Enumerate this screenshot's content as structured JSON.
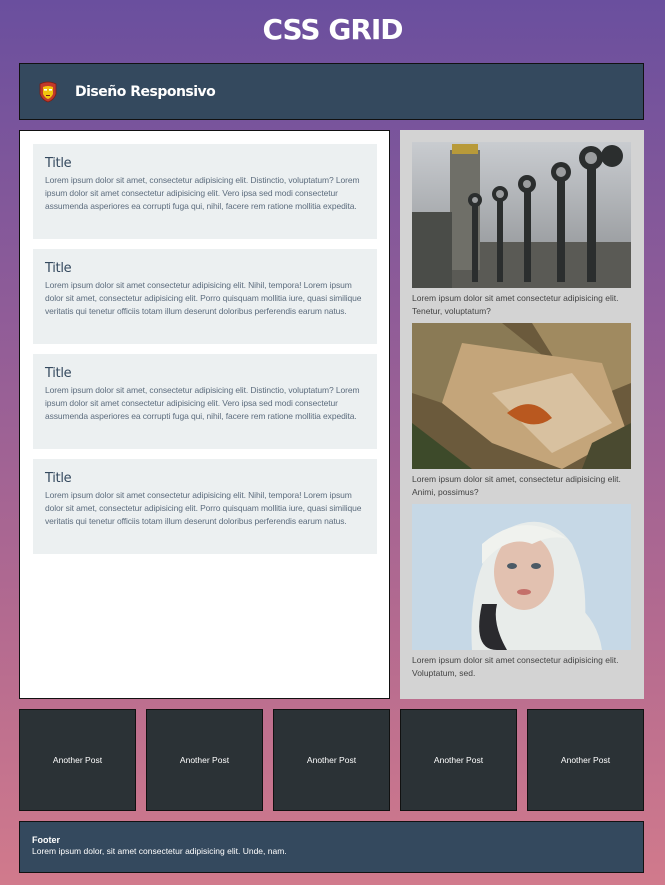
{
  "page": {
    "title": "CSS GRID"
  },
  "header": {
    "brand": "Diseño Responsivo",
    "logo_icon": "iron-man-mask-icon"
  },
  "main": {
    "cards": [
      {
        "title": "Title",
        "text": "Lorem ipsum dolor sit amet, consectetur adipisicing elit. Distinctio, voluptatum? Lorem ipsum dolor sit amet consectetur adipisicing elit. Vero ipsa sed modi consectetur assumenda asperiores ea corrupti fuga qui, nihil, facere rem ratione mollitia expedita."
      },
      {
        "title": "Title",
        "text": "Lorem ipsum dolor sit amet consectetur adipisicing elit. Nihil, tempora! Lorem ipsum dolor sit amet, consectetur adipisicing elit. Porro quisquam mollitia iure, quasi similique veritatis qui tenetur officiis totam illum deserunt doloribus perferendis earum natus."
      },
      {
        "title": "Title",
        "text": "Lorem ipsum dolor sit amet, consectetur adipisicing elit. Distinctio, voluptatum? Lorem ipsum dolor sit amet consectetur adipisicing elit. Vero ipsa sed modi consectetur assumenda asperiores ea corrupti fuga qui, nihil, facere rem ratione mollitia expedita."
      },
      {
        "title": "Title",
        "text": "Lorem ipsum dolor sit amet consectetur adipisicing elit. Nihil, tempora! Lorem ipsum dolor sit amet, consectetur adipisicing elit. Porro quisquam mollitia iure, quasi similique veritatis qui tenetur officiis totam illum deserunt doloribus perferendis earum natus."
      }
    ]
  },
  "aside": {
    "items": [
      {
        "image": "street-lamps-photo",
        "caption": "Lorem ipsum dolor sit amet consectetur adipisicing elit. Tenetur, voluptatum?"
      },
      {
        "image": "rock-and-leaf-photo",
        "caption": "Lorem ipsum dolor sit amet, consectetur adipisicing elit. Animi, possimus?"
      },
      {
        "image": "blonde-woman-portrait-photo",
        "caption": "Lorem ipsum dolor sit amet consectetur adipisicing elit. Voluptatum, sed."
      }
    ]
  },
  "posts": [
    {
      "label": "Another Post"
    },
    {
      "label": "Another Post"
    },
    {
      "label": "Another Post"
    },
    {
      "label": "Another Post"
    },
    {
      "label": "Another Post"
    }
  ],
  "footer": {
    "title": "Footer",
    "text": "Lorem ipsum dolor, sit amet consectetur adipisicing elit. Unde, nam."
  },
  "colors": {
    "header_bg": "#34495e",
    "card_bg": "#ecf0f1",
    "aside_bg": "#d3d3d3",
    "post_bg": "#2b3236"
  }
}
